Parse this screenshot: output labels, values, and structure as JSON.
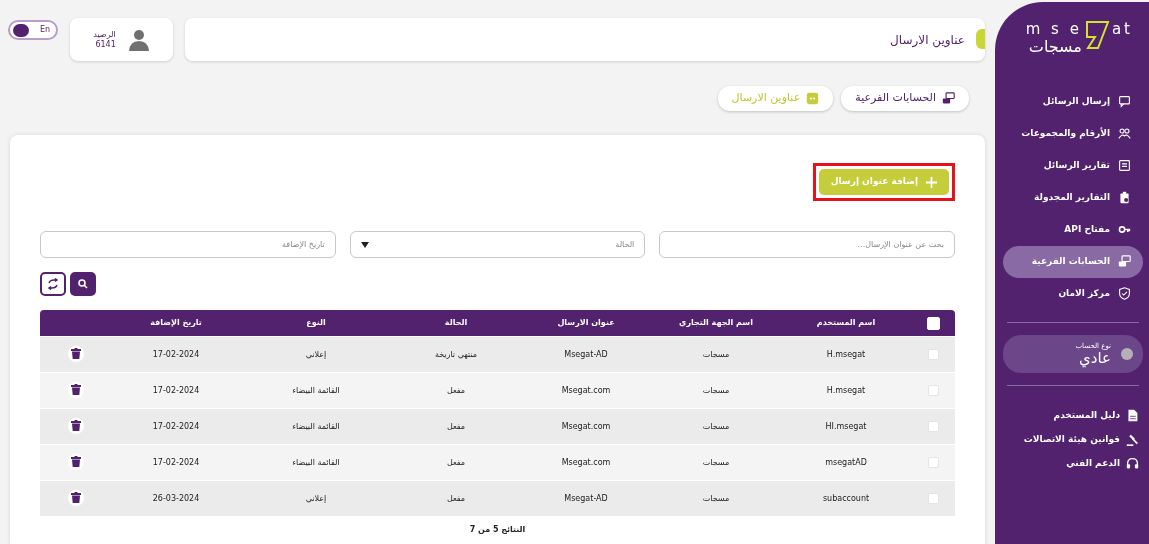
{
  "sidebar": {
    "logo": {
      "latin_left": "m s e",
      "latin_right": "at",
      "arabic": "مسجات"
    },
    "items": [
      {
        "label": "إرسال الرسائل",
        "selected": false
      },
      {
        "label": "الأرقام والمجموعات",
        "selected": false
      },
      {
        "label": "تقارير الرسائل",
        "selected": false
      },
      {
        "label": "التقارير المجدولة",
        "selected": false
      },
      {
        "label": "API مفتاح",
        "selected": false
      },
      {
        "label": "الحسابات الفرعية",
        "selected": true
      },
      {
        "label": "مركز الامان",
        "selected": false
      }
    ],
    "account_type": {
      "label": "نوع الحساب",
      "value": "عادي"
    },
    "links": [
      {
        "label": "دليل المستخدم"
      },
      {
        "label": "قوانين هيئة الاتصالات"
      },
      {
        "label": "الدعم الفني"
      }
    ]
  },
  "header": {
    "title": "عناوين الارسال",
    "balance_label": "الرصيد",
    "balance": "6141",
    "language": {
      "label": "En",
      "on": false
    }
  },
  "tabs": [
    {
      "label": "الحسابات الفرعية",
      "selected": false
    },
    {
      "label": "عناوين الارسال",
      "selected": true
    }
  ],
  "add_button": {
    "label": "إضافة عنوان إرسال",
    "highlighted": true
  },
  "filters": [
    {
      "kind": "text",
      "placeholder": "بحث عن عنوان الإرسال..."
    },
    {
      "kind": "select",
      "placeholder": "الحالة"
    },
    {
      "kind": "text",
      "placeholder": "تاريخ الإضافة"
    }
  ],
  "table": {
    "columns": [
      "اسم المستخدم",
      "اسم الجهة التجاري",
      "عنوان الارسال",
      "الحالة",
      "النوع",
      "تاريخ الإضافة"
    ],
    "select_all": {
      "checked": false
    },
    "rows": [
      {
        "checked": false,
        "cells": [
          "H.msegat",
          "مسجات",
          "Msegat-AD",
          "منتهي تاريخة",
          "إعلاني",
          "17-02-2024"
        ]
      },
      {
        "checked": false,
        "cells": [
          "H.msegat",
          "مسجات",
          "Msegat.com",
          "مفعل",
          "القائمة البيضاء",
          "17-02-2024"
        ]
      },
      {
        "checked": false,
        "cells": [
          "HI.msegat",
          "مسجات",
          "Msegat.com",
          "مفعل",
          "القائمة البيضاء",
          "17-02-2024"
        ]
      },
      {
        "checked": false,
        "cells": [
          "msegatAD",
          "مسجات",
          "Msegat.com",
          "مفعل",
          "القائمة البيضاء",
          "17-02-2024"
        ]
      },
      {
        "checked": false,
        "cells": [
          "subaccount",
          "مسجات",
          "Msegat-AD",
          "مفعل",
          "إعلاني",
          "26-03-2024"
        ]
      }
    ],
    "footer": "النتائج 5 من 7"
  }
}
